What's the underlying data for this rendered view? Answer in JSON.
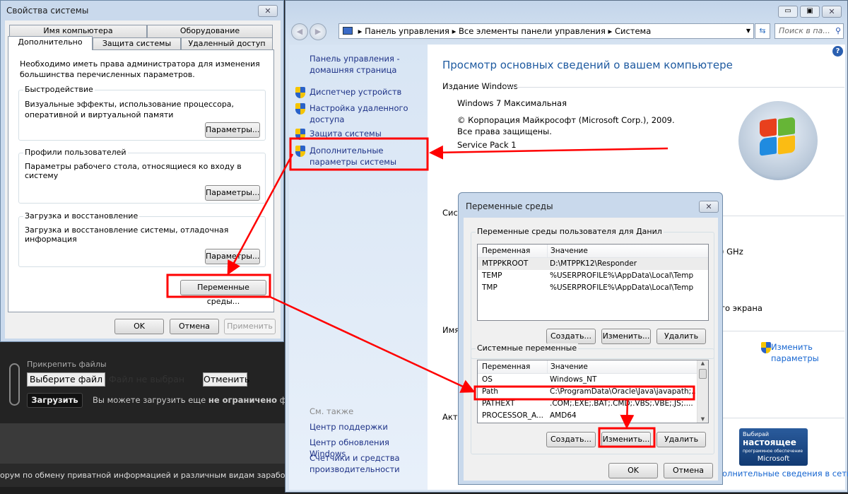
{
  "sysprops": {
    "title": "Свойства системы",
    "tabs_row1": [
      "Имя компьютера",
      "Оборудование"
    ],
    "tabs_row2": [
      "Дополнительно",
      "Защита системы",
      "Удаленный доступ"
    ],
    "active_tab": "Дополнительно",
    "admin_note": "Необходимо иметь права администратора для изменения большинства перечисленных параметров.",
    "groups": [
      {
        "label": "Быстродействие",
        "text": "Визуальные эффекты, использование процессора, оперативной и виртуальной памяти",
        "button": "Параметры..."
      },
      {
        "label": "Профили пользователей",
        "text": "Параметры рабочего стола, относящиеся ко входу в систему",
        "button": "Параметры..."
      },
      {
        "label": "Загрузка и восстановление",
        "text": "Загрузка и восстановление системы, отладочная информация",
        "button": "Параметры..."
      }
    ],
    "env_button": "Переменные среды...",
    "ok": "OK",
    "cancel": "Отмена",
    "apply": "Применить"
  },
  "forum": {
    "attach_label": "Прикрепить файлы",
    "choose_file": "Выберите файл",
    "no_file": "Файл не выбран",
    "cancel": "Отменить",
    "upload": "Загрузить",
    "upload_note_pre": "Вы можете загрузить еще ",
    "upload_note_bold": "не ограничено",
    "upload_note_post": " файлов",
    "footer": "орум по обмену приватной информацией и различным видам заработка  →  Бол"
  },
  "control_panel": {
    "breadcrumb": [
      "Панель управления",
      "Все элементы панели управления",
      "Система"
    ],
    "search_placeholder": "Поиск в па...",
    "nav_home": "Панель управления - домашняя страница",
    "nav_links": [
      "Диспетчер устройств",
      "Настройка удаленного доступа",
      "Защита системы",
      "Дополнительные параметры системы"
    ],
    "see_also": "См. также",
    "see_also_links": [
      "Центр поддержки",
      "Центр обновления Windows",
      "Счетчики и средства производительности"
    ],
    "heading": "Просмотр основных сведений о вашем компьютере",
    "edition_header": "Издание Windows",
    "edition": "Windows 7 Максимальная",
    "copyright": "© Корпорация Майкрософт (Microsoft Corp.), 2009. Все права защищены.",
    "service_pack": "Service Pack 1",
    "partial_system": "Сист",
    "partial_ghz": ") GHz",
    "partial_screen": "го экрана",
    "partial_name": "Имя",
    "partial_activation": "Акти",
    "change_params": "Изменить параметры",
    "genuine_badge": [
      "Выбирай",
      "настоящее",
      "программное обеспечение",
      "Microsoft"
    ],
    "more_online": "олнительные сведения в сети..."
  },
  "env_dialog": {
    "title": "Переменные среды",
    "user_group": "Переменные среды пользователя для Данил",
    "columns": [
      "Переменная",
      "Значение"
    ],
    "user_vars": [
      [
        "MTPPKROOT",
        "D:\\MTPPK12\\Responder"
      ],
      [
        "TEMP",
        "%USERPROFILE%\\AppData\\Local\\Temp"
      ],
      [
        "TMP",
        "%USERPROFILE%\\AppData\\Local\\Temp"
      ]
    ],
    "system_group": "Системные переменные",
    "system_vars": [
      [
        "OS",
        "Windows_NT"
      ],
      [
        "Path",
        "C:\\ProgramData\\Oracle\\Java\\javapath;..."
      ],
      [
        "PATHEXT",
        ".COM;.EXE;.BAT;.CMD;.VBS;.VBE;.JS;...."
      ],
      [
        "PROCESSOR_A...",
        "AMD64"
      ]
    ],
    "create": "Создать...",
    "edit": "Изменить...",
    "delete": "Удалить",
    "ok": "OK",
    "cancel": "Отмена"
  },
  "colors": {
    "annotation": "#ff0000",
    "link": "#1e3287",
    "heading": "#1e5aa0"
  }
}
